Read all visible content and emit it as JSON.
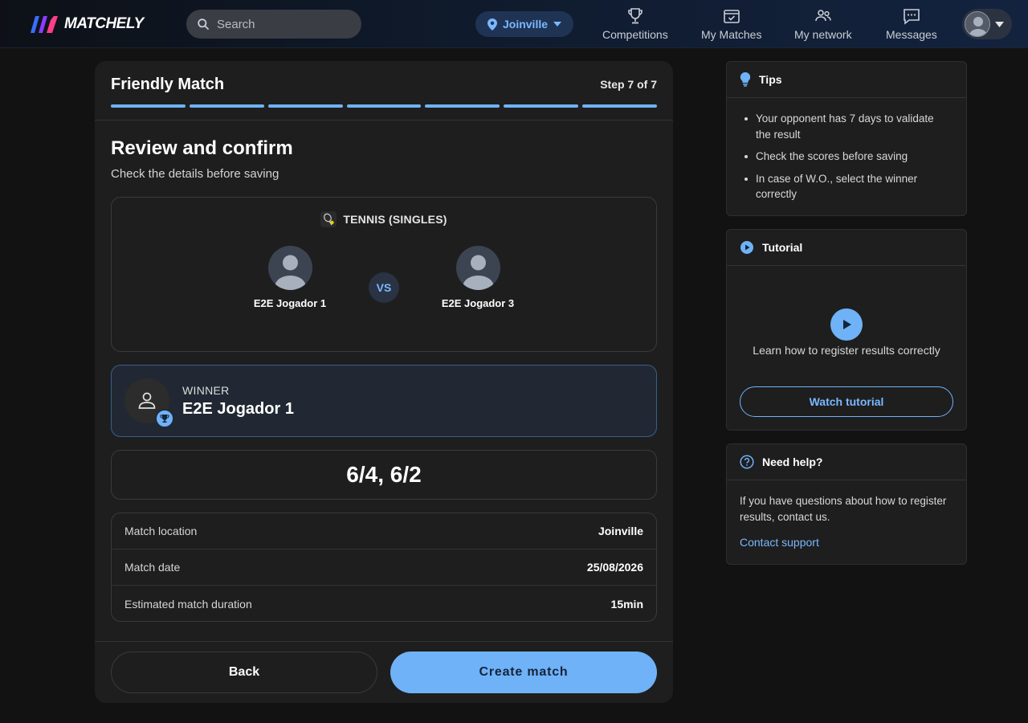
{
  "app": {
    "name": "MATCHELY"
  },
  "search": {
    "placeholder": "Search",
    "value": ""
  },
  "location": {
    "label": "Joinville"
  },
  "nav": {
    "items": [
      {
        "label": "Competitions",
        "icon": "trophy-icon"
      },
      {
        "label": "My Matches",
        "icon": "calendar-check-icon"
      },
      {
        "label": "My network",
        "icon": "people-icon"
      },
      {
        "label": "Messages",
        "icon": "chat-icon"
      }
    ]
  },
  "card": {
    "title": "Friendly Match",
    "step": "Step 7 of 7",
    "progress": {
      "current": 7,
      "total": 7
    },
    "heading": "Review and confirm",
    "subheading": "Check the details before saving",
    "sport": "TENNIS (SINGLES)",
    "vs": "VS",
    "player1": "E2E Jogador 1",
    "player2": "E2E Jogador 3",
    "winner_label": "WINNER",
    "winner_name": "E2E Jogador 1",
    "score": "6/4, 6/2",
    "details": [
      {
        "label": "Match location",
        "value": "Joinville"
      },
      {
        "label": "Match date",
        "value": "25/08/2026"
      },
      {
        "label": "Estimated match duration",
        "value": "15min"
      }
    ],
    "back_label": "Back",
    "create_label": "Create match"
  },
  "tips": {
    "title": "Tips",
    "items": [
      "Your opponent has 7 days to validate the result",
      "Check the scores before saving",
      "In case of W.O., select the winner correctly"
    ]
  },
  "tutorial": {
    "title": "Tutorial",
    "text": "Learn how to register results correctly",
    "button": "Watch tutorial"
  },
  "help": {
    "title": "Need help?",
    "text": "If you have questions about how to register results, contact us.",
    "link": "Contact support"
  },
  "colors": {
    "accent": "#6fb2f7",
    "background": "#121212",
    "card": "#1e1e1e"
  }
}
